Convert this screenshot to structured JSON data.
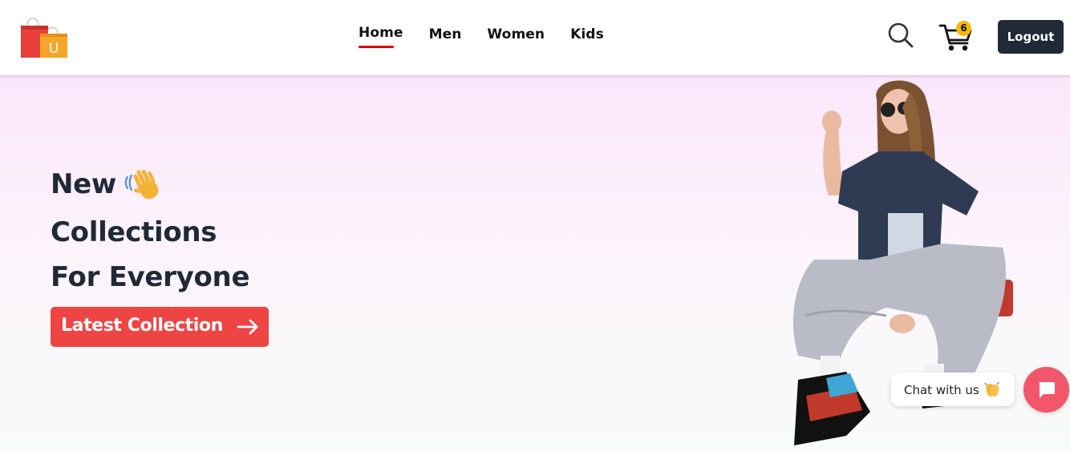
{
  "brand": {
    "logo_icon": "shopping-bags-icon",
    "logo_letter": "U",
    "colors": {
      "bag_red": "#e8413b",
      "bag_orange": "#f4a62a"
    }
  },
  "nav": {
    "items": [
      {
        "label": "Home",
        "active": true
      },
      {
        "label": "Men",
        "active": false
      },
      {
        "label": "Women",
        "active": false
      },
      {
        "label": "Kids",
        "active": false
      }
    ],
    "active_underline_color": "#e00000"
  },
  "header_actions": {
    "search_icon": "search-icon",
    "cart_icon": "cart-icon",
    "cart_count": "6",
    "logout_label": "Logout"
  },
  "hero": {
    "headline_line1": "New",
    "headline_line2": "Collections",
    "headline_line3": "For Everyone",
    "wave_icon": "waving-hand-icon",
    "cta_label": "Latest Collection",
    "cta_icon": "arrow-right-icon",
    "cta_color": "#ef4444",
    "text_color": "#1f2937"
  },
  "chat": {
    "label": "Chat with us",
    "clap_icon": "clapping-hands-icon",
    "fab_icon": "chat-bubble-icon",
    "fab_color": "#f2566b"
  }
}
